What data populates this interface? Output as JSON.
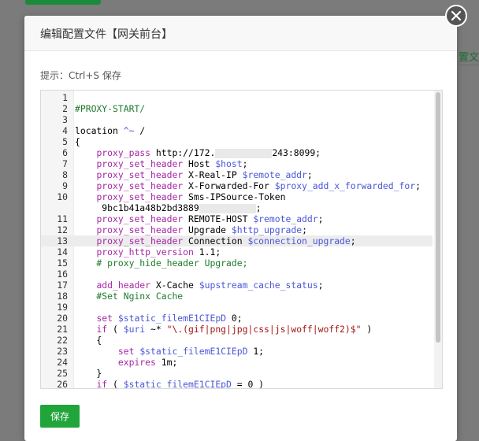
{
  "background": {
    "side_text": "置文"
  },
  "dialog": {
    "title": "编辑配置文件【网关前台】",
    "hint": "提示：Ctrl+S 保存",
    "save_label": "保存"
  },
  "colors": {
    "accent": "#20a53a",
    "keyword": "#a626a4",
    "variable": "#4b56d6",
    "comment": "#1f7a2c"
  },
  "icons": {
    "close": "close-icon"
  },
  "editor": {
    "lines": [
      {
        "n": "1",
        "t": ""
      },
      {
        "n": "2",
        "t": "#PROXY-START/"
      },
      {
        "n": "3",
        "t": ""
      },
      {
        "n": "4",
        "t": "location ^~ /"
      },
      {
        "n": "5",
        "t": "{"
      },
      {
        "n": "6",
        "t": "    proxy_pass http://172.[redacted]243:8099;"
      },
      {
        "n": "7",
        "t": "    proxy_set_header Host $host;"
      },
      {
        "n": "8",
        "t": "    proxy_set_header X-Real-IP $remote_addr;"
      },
      {
        "n": "9",
        "t": "    proxy_set_header X-Forwarded-For $proxy_add_x_forwarded_for;"
      },
      {
        "n": "10",
        "t": "    proxy_set_header Sms-IPSource-Token 9bc1b41a48b2bd3889[redacted];"
      },
      {
        "n": "11",
        "t": "    proxy_set_header REMOTE-HOST $remote_addr;"
      },
      {
        "n": "12",
        "t": "    proxy_set_header Upgrade $http_upgrade;"
      },
      {
        "n": "13",
        "t": "    proxy_set_header Connection $connection_upgrade;"
      },
      {
        "n": "14",
        "t": "    proxy_http_version 1.1;"
      },
      {
        "n": "15",
        "t": "    # proxy_hide_header Upgrade;"
      },
      {
        "n": "16",
        "t": ""
      },
      {
        "n": "17",
        "t": "    add_header X-Cache $upstream_cache_status;"
      },
      {
        "n": "18",
        "t": "    #Set Nginx Cache"
      },
      {
        "n": "19",
        "t": ""
      },
      {
        "n": "20",
        "t": "    set $static_filemE1CIEpD 0;"
      },
      {
        "n": "21",
        "t": "    if ( $uri ~* \"\\.(gif|png|jpg|css|js|woff|woff2)$\" )"
      },
      {
        "n": "22",
        "t": "    {"
      },
      {
        "n": "23",
        "t": "        set $static_filemE1CIEpD 1;"
      },
      {
        "n": "24",
        "t": "        expires 1m;"
      },
      {
        "n": "25",
        "t": "    }"
      },
      {
        "n": "26",
        "t": "    if ( $static_filemE1CIEpD = 0 )"
      }
    ]
  }
}
